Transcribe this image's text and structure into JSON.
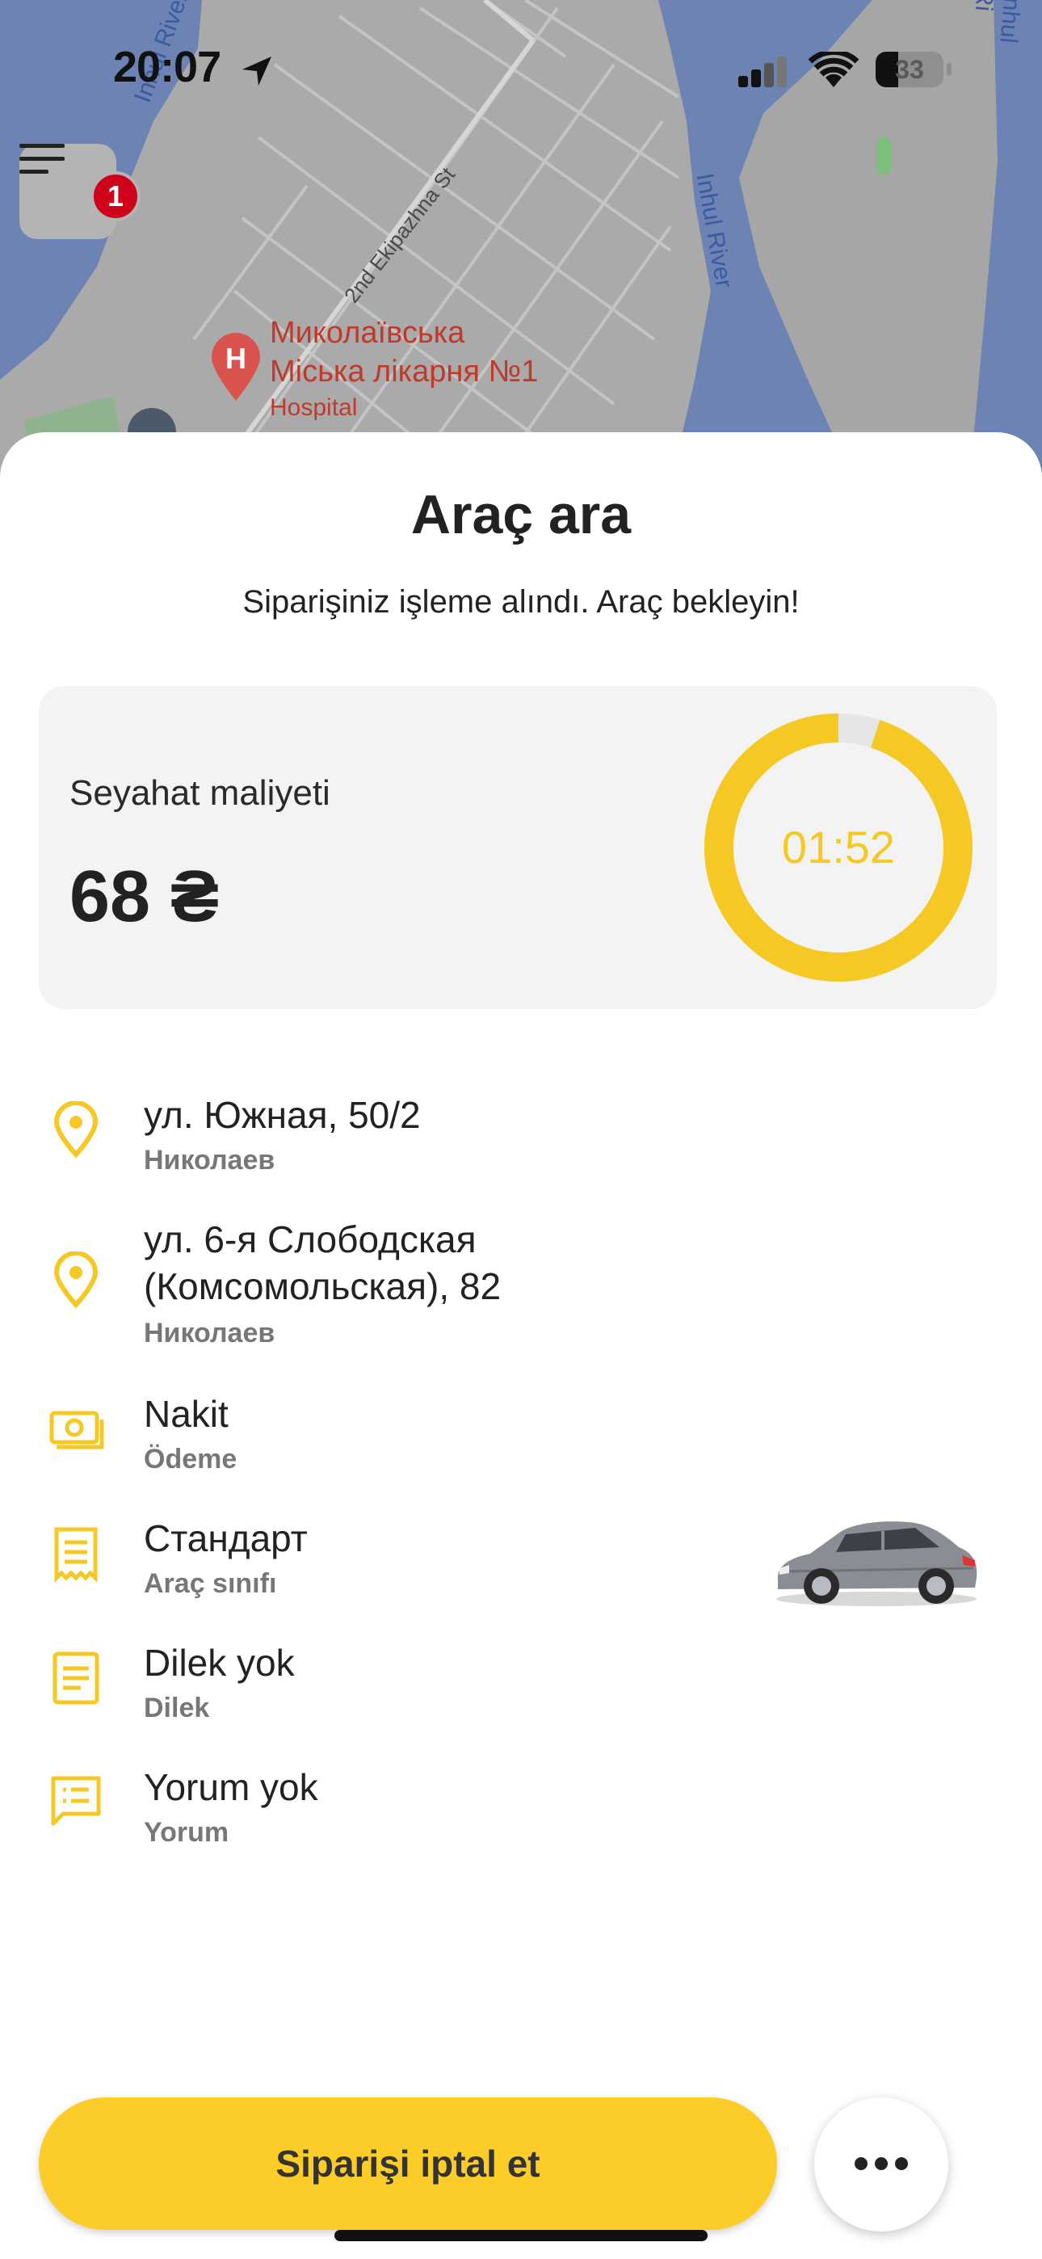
{
  "status_bar": {
    "time": "20:07",
    "battery": "33",
    "icons": [
      "location-arrow-icon",
      "cellular-signal-icon",
      "wifi-icon",
      "battery-icon"
    ]
  },
  "map": {
    "street": "2nd Ekipazhna St",
    "river_left": "Inhul River",
    "river_center": "Inhul River",
    "river_right": "Inhul Ri",
    "poi_name_line1": "Миколаївська",
    "poi_name_line2": "Міська лікарня №1",
    "poi_type": "Hospital",
    "poi_marker": "H"
  },
  "menu": {
    "icon": "menu-icon",
    "badge": "1"
  },
  "sheet": {
    "title": "Araç ara",
    "subtitle": "Siparişiniz işleme alındı. Araç bekleyin!",
    "cost": {
      "label": "Seyahat maliyeti",
      "value": "68 ₴"
    },
    "timer": {
      "value": "01:52",
      "progress": 0.95,
      "color": "#f5c824"
    },
    "rows": [
      {
        "icon": "location-pin-icon",
        "title": "ул. Южная, 50/2",
        "subtitle": "Николаев"
      },
      {
        "icon": "location-pin-icon",
        "title_line1": "ул. 6-я Слободская",
        "title_line2": "(Комсомольская), 82",
        "subtitle": "Николаев"
      },
      {
        "icon": "cash-icon",
        "title": "Nakit",
        "subtitle": "Ödeme"
      },
      {
        "icon": "receipt-icon",
        "title": "Стандарт",
        "subtitle": "Araç sınıfı",
        "image": "car-image"
      },
      {
        "icon": "document-icon",
        "title": "Dilek yok",
        "subtitle": "Dilek"
      },
      {
        "icon": "comment-icon",
        "title": "Yorum yok",
        "subtitle": "Yorum"
      }
    ]
  },
  "actions": {
    "cancel_label": "Siparişi iptal et",
    "more_icon": "more-dots-icon"
  },
  "colors": {
    "accent": "#fccd29",
    "icon": "#f5c824",
    "card_bg": "#f3f3f3",
    "badge": "#d0021b"
  }
}
